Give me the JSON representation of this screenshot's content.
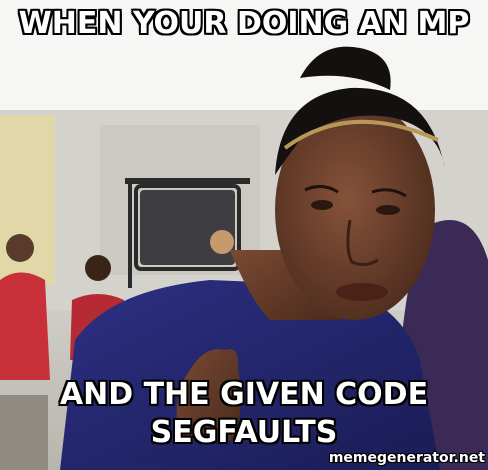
{
  "meme": {
    "top_text": "WHEN YOUR DOING AN MP",
    "bottom_text": "AND THE GIVEN CODE SEGFAULTS",
    "watermark": "memegenerator.net"
  },
  "colors": {
    "caption_fill": "#ffffff",
    "caption_stroke": "#000000",
    "sweater": "#24286b",
    "skin": "#6b3f2a"
  }
}
